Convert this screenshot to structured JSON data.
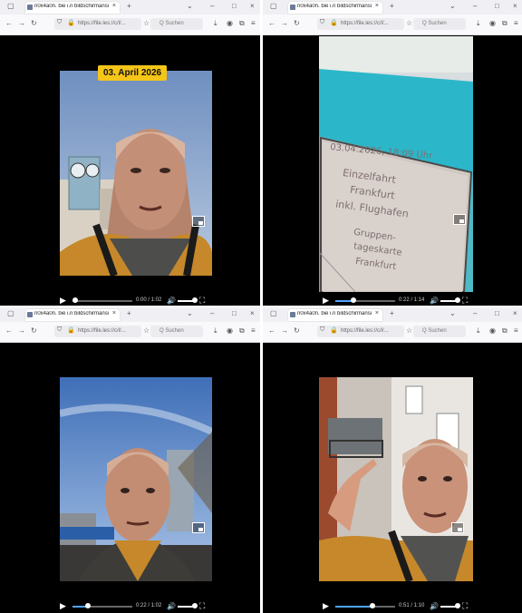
{
  "windows": [
    {
      "tab_title": "n0x4a0n. bie i.n bildschirmansicht",
      "url": "https://file.les://c/l/...",
      "search_placeholder": "Q  Suchen",
      "time": "0:00 / 1:02",
      "progress": 0.04,
      "overlay_date": "03. April 2026"
    },
    {
      "tab_title": "n0x4a0n. bie i.n bildschirmansicht",
      "url": "https://file.les://c/l/...",
      "search_placeholder": "Q  Suchen",
      "time": "0:22 / 1:14",
      "progress": 0.3,
      "ticket": {
        "line1": "03.04.2026, 18:09 Uhr",
        "line2": "Einzelfahrt",
        "line3": "Frankfurt",
        "line4": "inkl. Flughafen",
        "line5": "Gruppen-",
        "line6": "tageskarte",
        "line7": "Frankfurt"
      }
    },
    {
      "tab_title": "n0x4a0n. bie i.n bildschirmansicht",
      "url": "https://file.les://c/l/...",
      "search_placeholder": "Q  Suchen",
      "time": "0:22 / 1:02",
      "progress": 0.26
    },
    {
      "tab_title": "n0x4a0n. bie i.n bildschirmansicht",
      "url": "https://file.les://c/l/...",
      "search_placeholder": "Q  Suchen",
      "time": "0:51 / 1:10",
      "progress": 0.62
    }
  ],
  "icons": {
    "tab_list": "tab-list-icon",
    "new_tab": "plus-icon",
    "close": "close-icon",
    "back": "back-arrow-icon",
    "forward": "forward-arrow-icon",
    "reload": "reload-icon",
    "play": "play-icon",
    "volume": "volume-icon",
    "fullscreen": "fullscreen-icon",
    "pip": "picture-in-picture-icon"
  },
  "colors": {
    "tabbar_bg": "#f0f0f4",
    "toolbar_bg": "#f9f9fb",
    "video_bg": "#000000",
    "progress_fill": "#4fa3ff",
    "date_badge": "#f5c518"
  }
}
